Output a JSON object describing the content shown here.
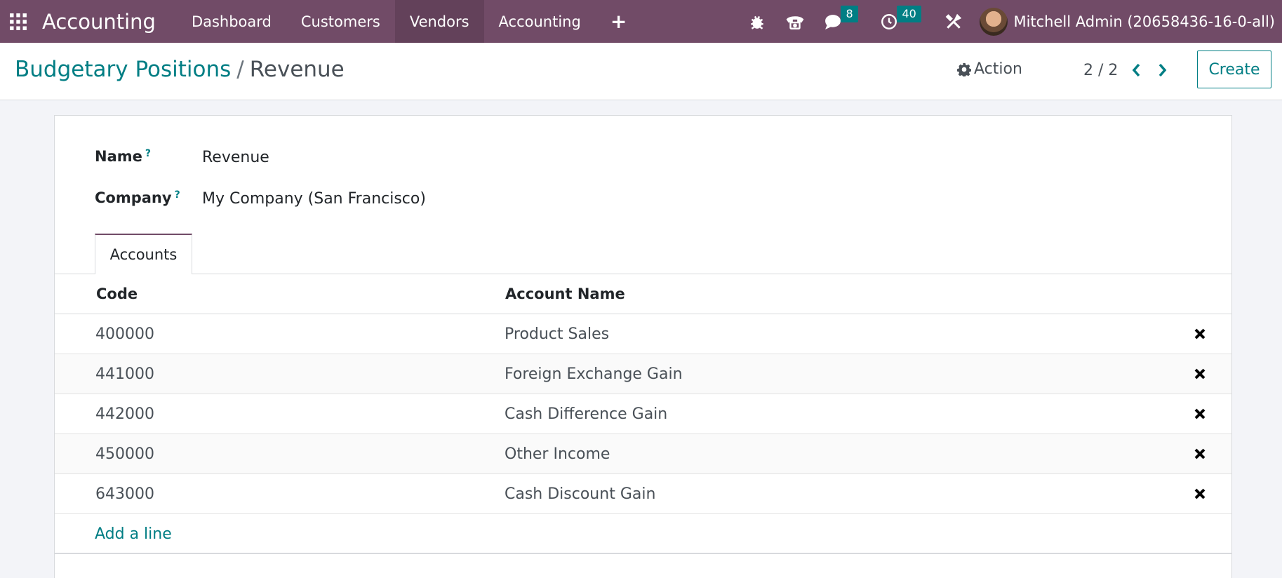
{
  "navbar": {
    "app_title": "Accounting",
    "menu": [
      "Dashboard",
      "Customers",
      "Vendors",
      "Accounting"
    ],
    "active_menu": "Vendors",
    "messages_count": "8",
    "activities_count": "40",
    "user_name": "Mitchell Admin (20658436-16-0-all)"
  },
  "breadcrumb": {
    "parent": "Budgetary Positions",
    "separator": "/",
    "current": "Revenue"
  },
  "control": {
    "action_label": "Action",
    "pager": "2 / 2",
    "create_label": "Create"
  },
  "form": {
    "name_label": "Name",
    "name_value": "Revenue",
    "company_label": "Company",
    "company_value": "My Company (San Francisco)",
    "help_mark": "?"
  },
  "tabs": {
    "accounts": "Accounts"
  },
  "table": {
    "headers": {
      "code": "Code",
      "account_name": "Account Name"
    },
    "rows": [
      {
        "code": "400000",
        "name": "Product Sales"
      },
      {
        "code": "441000",
        "name": "Foreign Exchange Gain"
      },
      {
        "code": "442000",
        "name": "Cash Difference Gain"
      },
      {
        "code": "450000",
        "name": "Other Income"
      },
      {
        "code": "643000",
        "name": "Cash Discount Gain"
      }
    ],
    "add_line": "Add a line"
  },
  "colors": {
    "navbar": "#714b67",
    "accent": "#017e84"
  }
}
